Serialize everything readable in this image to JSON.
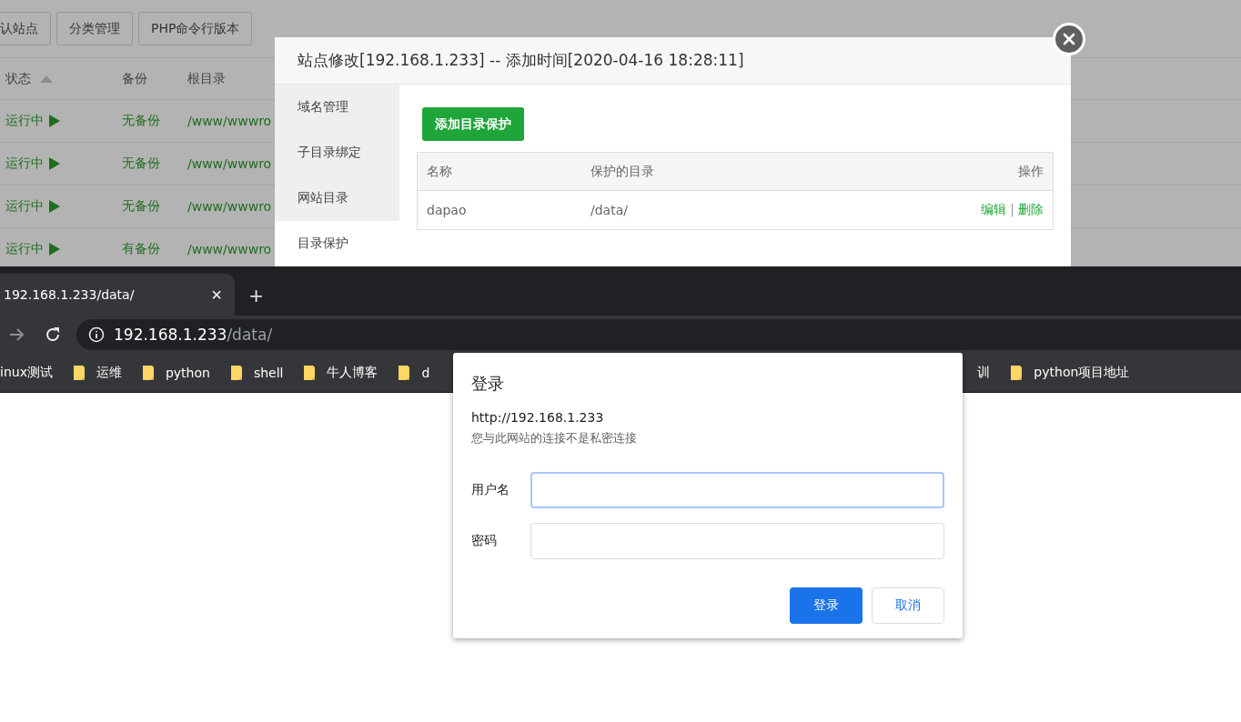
{
  "panel": {
    "toolbar_buttons": [
      "认站点",
      "分类管理",
      "PHP命令行版本"
    ],
    "table": {
      "columns": [
        {
          "label": "状态",
          "sorted": true
        },
        {
          "label": "备份",
          "sorted": false
        },
        {
          "label": "根目录",
          "sorted": false
        }
      ],
      "rows": [
        {
          "status": "运行中",
          "backup": "无备份",
          "root": "/www/wwwro"
        },
        {
          "status": "运行中",
          "backup": "无备份",
          "root": "/www/wwwro"
        },
        {
          "status": "运行中",
          "backup": "无备份",
          "root": "/www/wwwro"
        },
        {
          "status": "运行中",
          "backup": "有备份",
          "root": "/www/wwwro"
        }
      ]
    }
  },
  "modal": {
    "title": "站点修改[192.168.1.233] -- 添加时间[2020-04-16 18:28:11]",
    "sidebar": [
      {
        "label": "域名管理",
        "selected": false
      },
      {
        "label": "子目录绑定",
        "selected": false
      },
      {
        "label": "网站目录",
        "selected": false
      },
      {
        "label": "目录保护",
        "selected": true
      }
    ],
    "add_button": "添加目录保护",
    "table": {
      "columns": [
        "名称",
        "保护的目录",
        "操作"
      ],
      "rows": [
        {
          "name": "dapao",
          "directory": "/data/",
          "actions": [
            "编辑",
            "删除"
          ],
          "separator": "|"
        }
      ]
    }
  },
  "browser": {
    "tab": {
      "title": "192.168.1.233/data/",
      "close": "×"
    },
    "new_tab": "+",
    "address": {
      "host": "192.168.1.233",
      "path": "/data/"
    },
    "bookmarks": [
      {
        "label": "inux测试",
        "kind": "cut"
      },
      {
        "label": "运维",
        "kind": "folder"
      },
      {
        "label": "python",
        "kind": "folder"
      },
      {
        "label": "shell",
        "kind": "folder"
      },
      {
        "label": "牛人博客",
        "kind": "folder"
      },
      {
        "label": "d",
        "kind": "folder"
      },
      {
        "label": "训",
        "kind": "cut"
      },
      {
        "label": "python项目地址",
        "kind": "folder"
      }
    ]
  },
  "login_dialog": {
    "title": "登录",
    "url": "http://192.168.1.233",
    "note": "您与此网站的连接不是私密连接",
    "fields": [
      {
        "label": "用户名",
        "focused": true
      },
      {
        "label": "密码",
        "focused": false
      }
    ],
    "buttons": [
      {
        "label": "登录",
        "kind": "primary"
      },
      {
        "label": "取消",
        "kind": "secondary"
      }
    ]
  }
}
